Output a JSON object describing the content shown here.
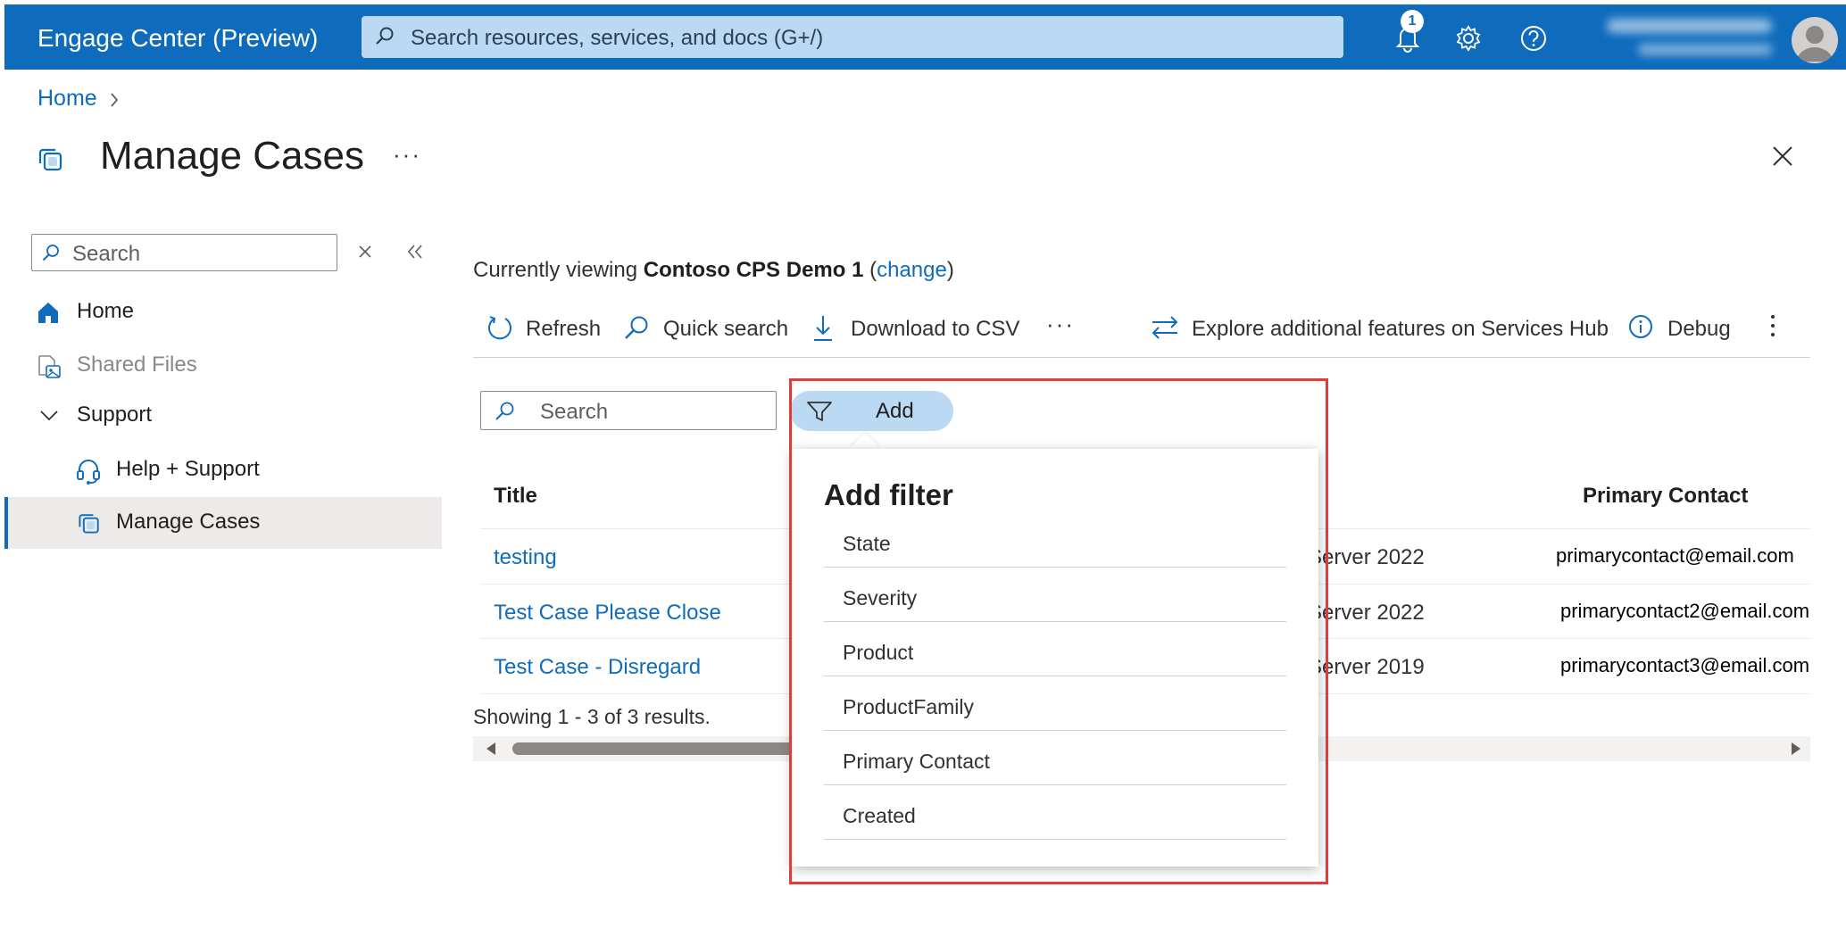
{
  "topbar": {
    "title": "Engage Center (Preview)",
    "search_placeholder": "Search resources, services, and docs (G+/)",
    "notification_count": "1",
    "accent_color": "#0f6cbd"
  },
  "breadcrumb": {
    "home": "Home"
  },
  "page": {
    "title": "Manage Cases",
    "more": "···"
  },
  "sidebar": {
    "search_placeholder": "Search",
    "items": [
      {
        "label": "Home",
        "icon": "home-icon"
      },
      {
        "label": "Shared Files",
        "icon": "shared-files-icon"
      },
      {
        "label": "Support",
        "icon": "chevron-down-icon"
      },
      {
        "label": "Help + Support",
        "icon": "headset-icon"
      },
      {
        "label": "Manage Cases",
        "icon": "cases-icon",
        "selected": true
      }
    ]
  },
  "main": {
    "viewing_prefix": "Currently viewing ",
    "viewing_name": "Contoso CPS Demo 1",
    "viewing_open": " (",
    "viewing_link": "change",
    "viewing_close": ")",
    "toolbar": {
      "refresh": "Refresh",
      "quick_search": "Quick search",
      "download": "Download to CSV",
      "more": "···",
      "explore": "Explore additional features on Services Hub",
      "debug": "Debug"
    },
    "grid_search_placeholder": "Search",
    "add_button": "Add",
    "columns": {
      "title": "Title",
      "primary_contact": "Primary Contact"
    },
    "rows": [
      {
        "title": "testing",
        "product": "Server 2022",
        "contact": "primarycontact@email.com"
      },
      {
        "title": "Test Case Please Close",
        "product": "Server 2022",
        "contact": "primarycontact2@email.com"
      },
      {
        "title": "Test Case - Disregard",
        "product": "Server 2019",
        "contact": "primarycontact3@email.com"
      }
    ],
    "showing": "Showing 1 - 3 of 3 results."
  },
  "filter_menu": {
    "heading": "Add filter",
    "options": [
      "State",
      "Severity",
      "Product",
      "ProductFamily",
      "Primary Contact",
      "Created"
    ]
  },
  "highlight_color": "#e03c3c"
}
